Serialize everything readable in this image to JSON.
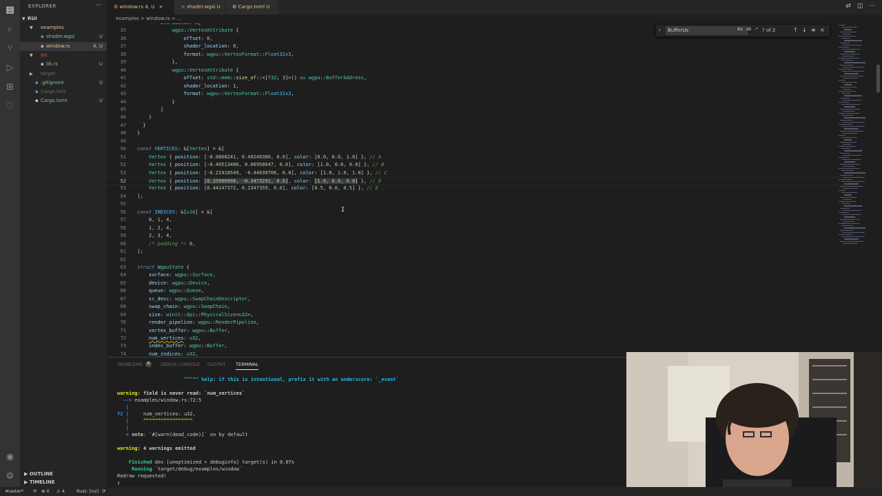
{
  "sidebar": {
    "title": "EXPLORER",
    "more": "···",
    "root": "RUI",
    "items": [
      {
        "label": "examples",
        "badge": "",
        "type": "folder-open",
        "color": "#e2c08d"
      },
      {
        "label": "shader.wgsl",
        "badge": "U",
        "type": "file",
        "color": "#73c991"
      },
      {
        "label": "window.rs",
        "badge": "4, U",
        "type": "file",
        "color": "#e2c08d"
      },
      {
        "label": "src",
        "badge": "",
        "type": "folder-open",
        "color": "#cc6633"
      },
      {
        "label": "lib.rs",
        "badge": "U",
        "type": "file",
        "color": "#73c991"
      },
      {
        "label": "target",
        "badge": "",
        "type": "folder",
        "color": "#6b6b6b"
      },
      {
        "label": ".gitignore",
        "badge": "U",
        "type": "file",
        "color": "#73c991"
      },
      {
        "label": "Cargo.lock",
        "badge": "",
        "type": "file",
        "color": "#6b6b6b"
      },
      {
        "label": "Cargo.toml",
        "badge": "U",
        "type": "file",
        "color": "#73c991"
      }
    ],
    "outline": "OUTLINE",
    "timeline": "TIMELINE"
  },
  "tabs": [
    {
      "label": "window.rs 4, U",
      "active": true
    },
    {
      "label": "shader.wgsl U",
      "active": false
    },
    {
      "label": "Cargo.toml U",
      "active": false
    }
  ],
  "breadcrumb": "examples > window.rs > ...",
  "find": {
    "query": "BufferUs",
    "opt_case": "Aa",
    "opt_word": "ab",
    "opt_regex": ".*",
    "count": "? of 2",
    "prev": "↑",
    "next": "↓",
    "sel": "≡",
    "close": "×"
  },
  "editor_lines": [
    {
      "n": "",
      "html": "        <span class='vr'>attributes</span>: &amp;["
    },
    {
      "n": "35",
      "html": "            <span class='ty'>wgpu</span>::<span class='ty'>VertexAttribute</span> {"
    },
    {
      "n": "36",
      "html": "                <span class='vr'>offset</span>: <span class='nm'>0</span>,"
    },
    {
      "n": "37",
      "html": "                <span class='vr'>shader_location</span>: <span class='nm'>0</span>,"
    },
    {
      "n": "38",
      "html": "                <span class='vr'>format</span>: <span class='ty'>wgpu</span>::<span class='ty'>VertexFormat</span>::<span class='cn'>Float32x3</span>,"
    },
    {
      "n": "39",
      "html": "            },"
    },
    {
      "n": "40",
      "html": "            <span class='ty'>wgpu</span>::<span class='ty'>VertexAttribute</span> {"
    },
    {
      "n": "41",
      "html": "                <span class='vr'>offset</span>: <span class='ty'>std</span>::<span class='ty'>mem</span>::<span class='fn'>size_of</span>::&lt;[<span class='ty'>f32</span>; <span class='nm'>3</span>]&gt;() <span class='kw'>as</span> <span class='ty'>wgpu</span>::<span class='ty'>BufferAddress</span>,"
    },
    {
      "n": "42",
      "html": "                <span class='vr'>shader_location</span>: <span class='nm'>1</span>,"
    },
    {
      "n": "43",
      "html": "                <span class='vr'>format</span>: <span class='ty'>wgpu</span>::<span class='ty'>VertexFormat</span>::<span class='cn'>Float32x3</span>,"
    },
    {
      "n": "44",
      "html": "            }"
    },
    {
      "n": "45",
      "html": "        ]"
    },
    {
      "n": "46",
      "html": "    }"
    },
    {
      "n": "47",
      "html": "  }"
    },
    {
      "n": "48",
      "html": "}"
    },
    {
      "n": "49",
      "html": ""
    },
    {
      "n": "50",
      "html": "<span class='kw'>const</span> <span class='cn'>VERTICES</span>: &amp;[<span class='ty'>Vertex</span>] = &amp;["
    },
    {
      "n": "51",
      "html": "    <span class='ty'>Vertex</span> { <span class='vr'>position</span>: [<span class='nm'>-0.0868241</span>, <span class='nm'>0.49240386</span>, <span class='nm'>0.0</span>], <span class='vr'>color</span>: [<span class='nm'>0.0</span>, <span class='nm'>0.0</span>, <span class='nm'>1.0</span>] }, <span class='cm'>// A</span>"
    },
    {
      "n": "52",
      "html": "    <span class='ty'>Vertex</span> { <span class='vr'>position</span>: [<span class='nm'>-0.49513406</span>, <span class='nm'>0.06958647</span>, <span class='nm'>0.0</span>], <span class='vr'>color</span>: [<span class='nm'>1.0</span>, <span class='nm'>0.0</span>, <span class='nm'>0.0</span>] }, <span class='cm'>// B</span>"
    },
    {
      "n": "53",
      "html": "    <span class='ty'>Vertex</span> { <span class='vr'>position</span>: [<span class='nm'>-0.21918549</span>, <span class='nm'>-0.44939706</span>, <span class='nm'>0.0</span>], <span class='vr'>color</span>: [<span class='nm'>1.0</span>, <span class='nm'>1.0</span>, <span class='nm'>1.0</span>] }, <span class='cm'>// C</span>"
    },
    {
      "n": "52",
      "html": "    <span class='ty'>Vertex</span> { <span class='vr'>position</span>: <span class='hl'>[<span class='nm'>0.35966998</span>, <span class='nm'>-0.3473291</span>, <span class='nm'>0.0</span>]</span>, <span class='vr'>color</span>: <span class='hl'>[<span class='nm'>1.0</span>, <span class='nm'>0.0</span>, <span class='nm'>0.0</span>]</span> }, <span class='cm'>// D</span>",
      "current": true
    },
    {
      "n": "53",
      "html": "    <span class='ty'>Vertex</span> { <span class='vr'>position</span>: [<span class='nm'>0.44147372</span>, <span class='nm'>0.2347359</span>, <span class='nm'>0.0</span>], <span class='vr'>color</span>: [<span class='nm'>0.5</span>, <span class='nm'>0.0</span>, <span class='nm'>0.5</span>] }, <span class='cm'>// E</span>"
    },
    {
      "n": "54",
      "html": "];"
    },
    {
      "n": "55",
      "html": ""
    },
    {
      "n": "56",
      "html": "<span class='kw'>const</span> <span class='cn'>INDICES</span>: &amp;[<span class='ty'>u16</span>] = &amp;["
    },
    {
      "n": "57",
      "html": "    <span class='nm'>0</span>, <span class='nm'>1</span>, <span class='nm'>4</span>,"
    },
    {
      "n": "58",
      "html": "    <span class='nm'>1</span>, <span class='nm'>2</span>, <span class='nm'>4</span>,"
    },
    {
      "n": "59",
      "html": "    <span class='nm'>2</span>, <span class='nm'>3</span>, <span class='nm'>4</span>,"
    },
    {
      "n": "60",
      "html": "    <span class='cm'>/* padding */</span> <span class='nm'>0</span>,"
    },
    {
      "n": "61",
      "html": "];"
    },
    {
      "n": "62",
      "html": ""
    },
    {
      "n": "63",
      "html": "<span class='kw'>struct</span> <span class='ty'>WgpuState</span> {"
    },
    {
      "n": "64",
      "html": "    <span class='vr'>surface</span>: <span class='ty'>wgpu</span>::<span class='ty'>Surface</span>,"
    },
    {
      "n": "65",
      "html": "    <span class='vr'>device</span>: <span class='ty'>wgpu</span>::<span class='ty'>Device</span>,"
    },
    {
      "n": "66",
      "html": "    <span class='vr'>queue</span>: <span class='ty'>wgpu</span>::<span class='ty'>Queue</span>,"
    },
    {
      "n": "67",
      "html": "    <span class='vr'>sc_desc</span>: <span class='ty'>wgpu</span>::<span class='ty'>SwapChainDescriptor</span>,"
    },
    {
      "n": "68",
      "html": "    <span class='vr'>swap_chain</span>: <span class='ty'>wgpu</span>::<span class='ty'>SwapChain</span>,"
    },
    {
      "n": "69",
      "html": "    <span class='vr'>size</span>: <span class='ty'>winit</span>::<span class='ty'>dpi</span>::<span class='ty'>PhysicalSize</span>&lt;<span class='ty'>u32</span>&gt;,"
    },
    {
      "n": "70",
      "html": "    <span class='vr'>render_pipeline</span>: <span class='ty'>wgpu</span>::<span class='ty'>RenderPipeline</span>,"
    },
    {
      "n": "71",
      "html": "    <span class='vr'>vertex_buffer</span>: <span class='ty'>wgpu</span>::<span class='ty'>Buffer</span>,"
    },
    {
      "n": "72",
      "html": "    <span class='vr' style='text-decoration: underline wavy #cca700;'>num_vertices</span>: <span class='ty'>u32</span>,"
    },
    {
      "n": "73",
      "html": "    <span class='vr'>index_buffer</span>: <span class='ty'>wgpu</span>::<span class='ty'>Buffer</span>,"
    },
    {
      "n": "74",
      "html": "    <span class='vr'>num_indices</span>: <span class='ty'>u32</span>,"
    }
  ],
  "panel": {
    "tabs": [
      "PROBLEMS",
      "DEBUG CONSOLE",
      "OUTPUT",
      "TERMINAL"
    ],
    "problems_count": "4",
    "terminal": [
      {
        "html": "                       <span class='tc'>^^^^^ help: if this is intentional, prefix it with an underscore: `_event`</span>"
      },
      {
        "html": ""
      },
      {
        "html": "<span class='ty2'>warning</span><span class='tb'>: field is never read: `num_vertices`</span>"
      },
      {
        "html": "  <span class='tbl'>--&gt;</span> examples/window.rs:72:5"
      },
      {
        "html": "   <span class='tbl'>|</span>"
      },
      {
        "html": "<span class='tbl'>72</span> <span class='tbl'>|</span>     num_vertices: u32,"
      },
      {
        "html": "   <span class='tbl'>|</span>     <span class='ty2'>^^^^^^^^^^^^^^^^^</span>"
      },
      {
        "html": "   <span class='tbl'>|</span>"
      },
      {
        "html": "   <span class='tbl'>=</span> <span class='tb'>note</span>: `#[warn(dead_code)]` on by default"
      },
      {
        "html": ""
      },
      {
        "html": "<span class='ty2'>warning</span><span class='tb'>: 4 warnings emitted</span>"
      },
      {
        "html": ""
      },
      {
        "html": "    <span class='tg'>Finished</span> dev [unoptimized + debuginfo] target(s) in 0.07s"
      },
      {
        "html": "     <span class='tg'>Running</span> `target/debug/examples/window`"
      },
      {
        "html": "Redraw requested!"
      },
      {
        "html": "▯"
      }
    ]
  },
  "status": {
    "branch": "master*",
    "sync": "⟳",
    "errors": "⊗ 0",
    "warnings": "⚠ 4",
    "lang": "Rust: [rui]",
    "sync2": "⟳"
  },
  "colors": {
    "activity": "#333333",
    "sidebar": "#252526",
    "editor": "#1e1e1e",
    "modified": "#e2c08d",
    "untracked": "#73c991"
  }
}
